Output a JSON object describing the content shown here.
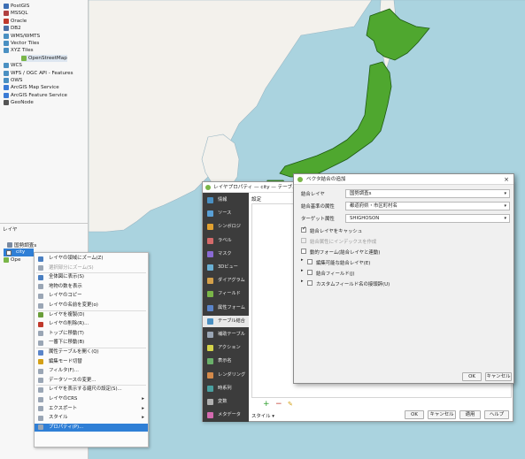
{
  "browser": {
    "items": [
      {
        "label": "PostGIS",
        "icon": "postgis-icon",
        "color": "#3d6fb4"
      },
      {
        "label": "MSSQL",
        "icon": "mssql-icon",
        "color": "#b04040"
      },
      {
        "label": "Oracle",
        "icon": "oracle-icon",
        "color": "#c0392b"
      },
      {
        "label": "DB2",
        "icon": "db2-icon",
        "color": "#4a6fa5"
      },
      {
        "label": "WMS/WMTS",
        "icon": "wms-icon",
        "color": "#4a90c2"
      },
      {
        "label": "Vector Tiles",
        "icon": "vector-tiles-icon",
        "color": "#4a90c2"
      },
      {
        "label": "XYZ Tiles",
        "icon": "xyz-icon",
        "color": "#4a90c2"
      },
      {
        "label": "OpenStreetMap",
        "icon": "osm-icon",
        "color": "#7ab648"
      },
      {
        "label": "WCS",
        "icon": "wcs-icon",
        "color": "#4a90c2"
      },
      {
        "label": "WFS / OGC API - Features",
        "icon": "wfs-icon",
        "color": "#4a90c2"
      },
      {
        "label": "OWS",
        "icon": "ows-icon",
        "color": "#4a90c2"
      },
      {
        "label": "ArcGIS Map Service",
        "icon": "arcgis-map-icon",
        "color": "#3a7bd5"
      },
      {
        "label": "ArcGIS Feature Service",
        "icon": "arcgis-feature-icon",
        "color": "#3a7bd5"
      },
      {
        "label": "GeoNode",
        "icon": "geonode-icon",
        "color": "#555555"
      }
    ]
  },
  "layers": {
    "title": "レイヤ",
    "items": [
      "国勢調査s",
      "city",
      "Ope"
    ]
  },
  "context_menu": {
    "items": [
      {
        "label": "レイヤの領域にズーム(Z)",
        "disabled": false
      },
      {
        "label": "選択部分にズーム(S)",
        "disabled": true
      },
      {
        "label": "全体図に表示(S)",
        "disabled": false
      },
      {
        "label": "地物の数を表示",
        "disabled": false
      },
      {
        "label": "レイヤのコピー",
        "disabled": false
      },
      {
        "label": "レイヤの名前を変更(o)",
        "disabled": false
      },
      {
        "label": "レイヤを複製(D)",
        "disabled": false
      },
      {
        "label": "レイヤの削除(R)...",
        "disabled": false
      },
      {
        "label": "トップに移動(T)",
        "disabled": false
      },
      {
        "label": "一番下に移動(B)",
        "disabled": false
      },
      {
        "label": "属性テーブルを開く(Q)",
        "disabled": false
      },
      {
        "label": "編集モード切替",
        "disabled": false
      },
      {
        "label": "フィルタ(F)...",
        "disabled": false
      },
      {
        "label": "データソースの変更...",
        "disabled": false
      },
      {
        "label": "レイヤを表示する縮尺の設定(S)...",
        "disabled": false
      },
      {
        "label": "レイヤのCRS",
        "disabled": false,
        "submenu": true
      },
      {
        "label": "エクスポート",
        "disabled": false,
        "submenu": true
      },
      {
        "label": "スタイル",
        "disabled": false,
        "submenu": true
      },
      {
        "label": "プロパティ(P)...",
        "disabled": false,
        "highlighted": true
      }
    ]
  },
  "props_window": {
    "title": "レイヤプロパティ — city — テーブル結合",
    "side_items": [
      "情報",
      "ソース",
      "シンボロジ",
      "ラベル",
      "マスク",
      "3Dビュー",
      "ダイアグラム",
      "フィールド",
      "属性フォーム",
      "テーブル結合",
      "補助テーブル",
      "アクション",
      "表示名",
      "レンダリング",
      "時系列",
      "変数",
      "メタデータ"
    ],
    "active_item": "テーブル結合",
    "pane_header": "設定",
    "style_label": "スタイル",
    "buttons": {
      "ok": "OK",
      "cancel": "キャンセル",
      "apply": "適用",
      "help": "ヘルプ"
    }
  },
  "join_dialog": {
    "title": "ベクタ結合の追加",
    "join_layer_label": "結合レイヤ",
    "join_layer_value": "国勢調査s",
    "join_field_label": "結合基準の属性",
    "join_field_value": "都道府県・市区町村名",
    "target_field_label": "ターゲット属性",
    "target_field_value": "SHIGHOSON",
    "cache_label": "結合レイヤをキャッシュ",
    "index_label": "結合属性にインデックスを作成",
    "dynamic_form_label": "動的フォーム(結合レイヤと連動)",
    "editable_label": "編集可能な結合レイヤ(E)",
    "fields_label": "結合フィールド(J)",
    "prefix_label": "カスタムフィールド名の接頭辞(U)",
    "ok": "OK",
    "cancel": "キャンセル"
  },
  "colors": {
    "sea": "#aad3df",
    "land_outside": "#ffffff",
    "japan_fill": "#4fa72f",
    "japan_border": "#1e5a12",
    "highlight": "#2f7fd6",
    "sidebar_dark": "#3c3c3c"
  }
}
